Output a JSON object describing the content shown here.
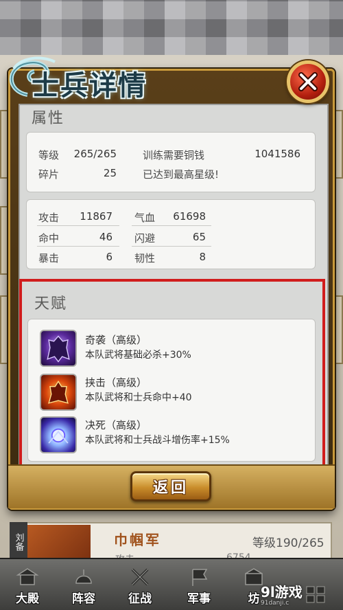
{
  "dialog": {
    "title": "士兵详情",
    "close_label": "×",
    "attributes": {
      "heading": "属性",
      "level_label": "等级",
      "level_value": "265/265",
      "fragments_label": "碎片",
      "fragments_value": "25",
      "train_cost_label": "训练需要铜钱",
      "train_cost_value": "1041586",
      "max_star_note": "已达到最高星级!"
    },
    "stats": {
      "attack_label": "攻击",
      "attack_value": "11867",
      "hp_label": "气血",
      "hp_value": "61698",
      "hit_label": "命中",
      "hit_value": "46",
      "dodge_label": "闪避",
      "dodge_value": "65",
      "crit_label": "暴击",
      "crit_value": "6",
      "toughness_label": "韧性",
      "toughness_value": "8"
    },
    "talents": {
      "heading": "天赋",
      "items": [
        {
          "name": "奇袭（高级）",
          "desc": "本队武将基础必杀+30%",
          "icon": "dark-warrior-icon"
        },
        {
          "name": "挟击（高级）",
          "desc": "本队武将和士兵命中+40",
          "icon": "fire-warrior-icon"
        },
        {
          "name": "决死（高级）",
          "desc": "本队武将和士兵战斗增伤率+15%",
          "icon": "fist-burst-icon"
        }
      ]
    },
    "back_label": "返回"
  },
  "underlying_card": {
    "tag": "刘备",
    "name": "巾帼军",
    "level": "等级190/265",
    "attack_label": "攻击",
    "attack_value": "6754"
  },
  "bottom_nav": [
    {
      "label": "大殿",
      "icon": "palace-icon"
    },
    {
      "label": "阵容",
      "icon": "helmet-icon"
    },
    {
      "label": "征战",
      "icon": "crossed-axes-icon"
    },
    {
      "label": "军事",
      "icon": "flag-icon"
    },
    {
      "label": "坊",
      "icon": "workshop-icon"
    },
    {
      "label": "",
      "icon": "grid-menu-icon"
    }
  ],
  "watermark": {
    "text": "9l游戏",
    "sub": "91danji.c"
  }
}
